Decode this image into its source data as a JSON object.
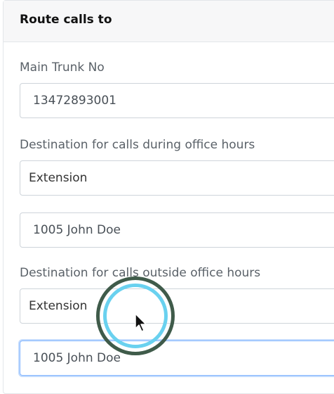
{
  "card": {
    "title": "Route calls to"
  },
  "main_trunk": {
    "label": "Main Trunk No",
    "value": "13472893001"
  },
  "office_hours": {
    "label": "Destination for calls during office hours",
    "type_value": "Extension",
    "target_value": "1005 John Doe"
  },
  "outside_hours": {
    "label": "Destination for calls outside office hours",
    "type_value": "Extension",
    "target_value": "1005 John Doe"
  }
}
